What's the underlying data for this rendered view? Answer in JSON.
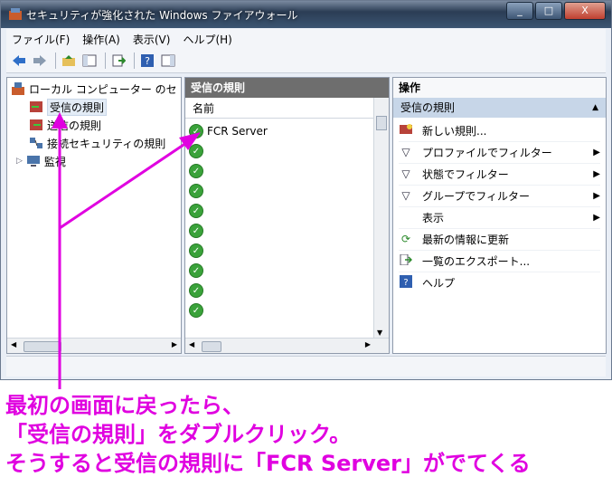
{
  "window": {
    "title": "セキュリティが強化された Windows ファイアウォール",
    "buttons": {
      "minimize": "_",
      "maximize": "□",
      "close": "X"
    }
  },
  "menu": [
    "ファイル(F)",
    "操作(A)",
    "表示(V)",
    "ヘルプ(H)"
  ],
  "tree": {
    "root": "ローカル コンピューター のセ",
    "items": [
      "受信の規則",
      "送信の規則",
      "接続セキュリティの規則",
      "監視"
    ]
  },
  "middle": {
    "header": "受信の規則",
    "column": "名前",
    "rows": [
      "FCR Server",
      "",
      "",
      "",
      "",
      "",
      "",
      "",
      "",
      ""
    ]
  },
  "actions": {
    "header": "操作",
    "section": "受信の規則",
    "items": [
      {
        "label": "新しい規則...",
        "icon": "new-rule-icon",
        "submenu": false
      },
      {
        "label": "プロファイルでフィルター",
        "icon": "filter-icon",
        "submenu": true
      },
      {
        "label": "状態でフィルター",
        "icon": "filter-icon",
        "submenu": true
      },
      {
        "label": "グループでフィルター",
        "icon": "filter-icon",
        "submenu": true
      },
      {
        "label": "表示",
        "icon": "",
        "submenu": true
      },
      {
        "label": "最新の情報に更新",
        "icon": "refresh-icon",
        "submenu": false
      },
      {
        "label": "一覧のエクスポート...",
        "icon": "export-icon",
        "submenu": false
      },
      {
        "label": "ヘルプ",
        "icon": "help-icon",
        "submenu": false
      }
    ]
  },
  "caption": {
    "line1": "最初の画面に戻ったら、",
    "line2": "「受信の規則」をダブルクリック。",
    "line3": "そうすると受信の規則に「FCR Server」がでてくる"
  },
  "colors": {
    "annotation": "#e000e0",
    "check": "#3aa23a",
    "title_bar": "#2b3d55"
  }
}
